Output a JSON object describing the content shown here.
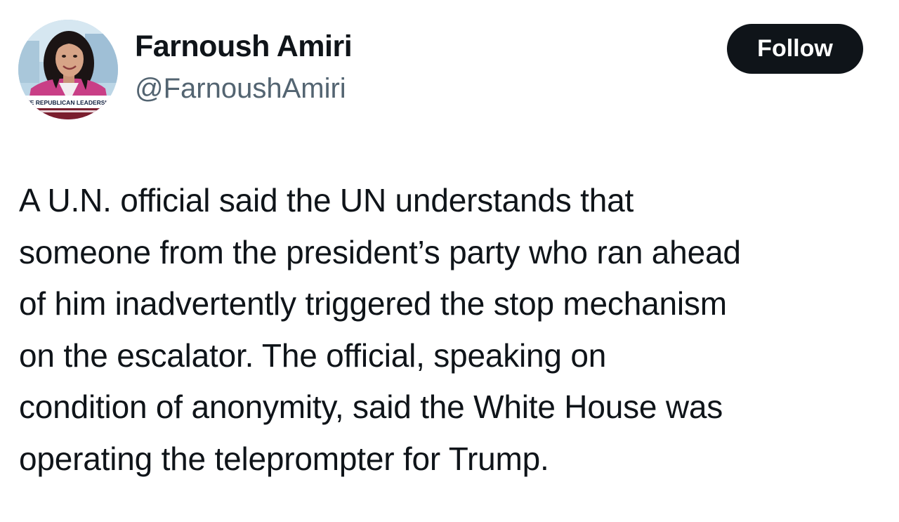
{
  "author": {
    "display_name": "Farnoush Amiri",
    "handle": "@FarnoushAmiri",
    "avatar_banner_text": "ATE REPUBLICAN LEADERSHIP"
  },
  "follow_button": {
    "label": "Follow"
  },
  "tweet": {
    "text": "A U.N. official said the UN understands that\nsomeone from the president’s party who ran ahead\nof him inadvertently triggered the stop mechanism\non the escalator. The official, speaking on\ncondition of anonymity, said the White House was\noperating the teleprompter for Trump."
  },
  "colors": {
    "text_primary": "#0f1419",
    "text_secondary": "#536471",
    "button_bg": "#0f1419",
    "button_text": "#ffffff",
    "background": "#ffffff"
  }
}
